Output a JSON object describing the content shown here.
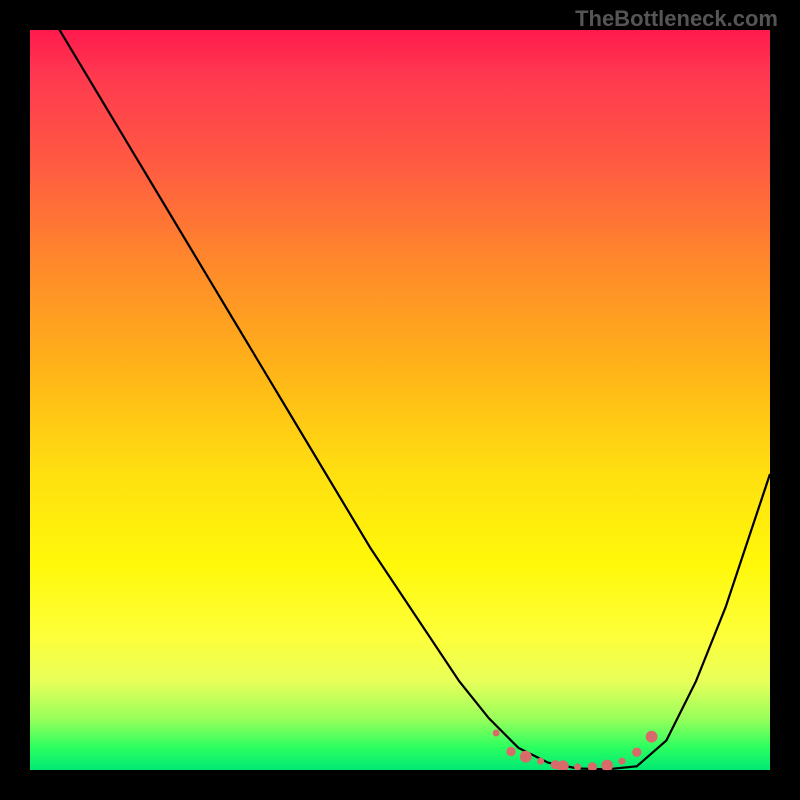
{
  "watermark": "TheBottleneck.com",
  "chart_data": {
    "type": "line",
    "title": "",
    "xlabel": "",
    "ylabel": "",
    "xlim": [
      0,
      100
    ],
    "ylim": [
      0,
      100
    ],
    "background_gradient": {
      "orientation": "vertical",
      "stops": [
        {
          "pos": 0,
          "color": "#ff1a4d"
        },
        {
          "pos": 50,
          "color": "#ffd400"
        },
        {
          "pos": 92,
          "color": "#f5ff40"
        },
        {
          "pos": 100,
          "color": "#00e874"
        }
      ]
    },
    "series": [
      {
        "name": "bottleneck-curve",
        "color": "#000000",
        "x": [
          0,
          4,
          10,
          16,
          22,
          28,
          34,
          40,
          46,
          52,
          58,
          62,
          66,
          70,
          74,
          78,
          82,
          86,
          90,
          94,
          98,
          100
        ],
        "y": [
          110,
          100,
          90,
          80,
          70,
          60,
          50,
          40,
          30,
          21,
          12,
          7,
          3,
          1,
          0.2,
          0.1,
          0.5,
          4,
          12,
          22,
          34,
          40
        ]
      }
    ],
    "scatter": {
      "name": "near-minimum-points",
      "color": "#d86a6a",
      "x": [
        63,
        65,
        67,
        69,
        71,
        72,
        74,
        76,
        78,
        80,
        82,
        84
      ],
      "y": [
        5,
        2.5,
        1.8,
        1.2,
        0.7,
        0.5,
        0.4,
        0.4,
        0.6,
        1.2,
        2.4,
        4.5
      ]
    }
  }
}
